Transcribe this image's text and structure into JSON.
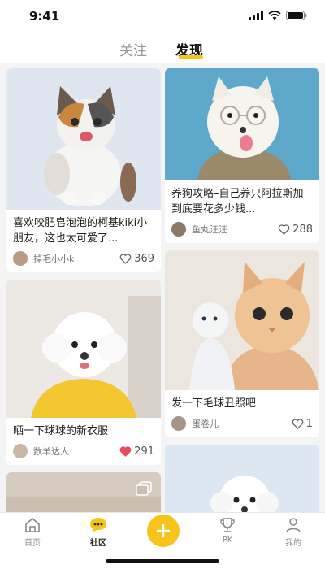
{
  "status_bar": {
    "time": "9:41"
  },
  "top_tabs": {
    "follow": "关注",
    "discover": "发现",
    "active": "discover"
  },
  "feed": {
    "left": [
      {
        "title": "喜欢咬肥皂泡泡的柯基kiki小朋友，这也太可爱了...",
        "author": "掉毛小小k",
        "likes": "369",
        "liked": false,
        "image": "calico-kitten-photo"
      },
      {
        "title": "晒一下球球的新衣服",
        "author": "数羊达人",
        "likes": "291",
        "liked": true,
        "image": "white-poodle-yellow-shirt-photo"
      },
      {
        "image": "partial-photo-with-multi-image-icon"
      }
    ],
    "right": [
      {
        "title": "养狗攻略–自己养只阿拉斯加到底要花多少钱...",
        "author": "鱼丸汪汪",
        "likes": "288",
        "liked": false,
        "image": "samoyed-with-glasses-photo"
      },
      {
        "title": "发一下毛球丑照吧",
        "author": "蛋卷儿",
        "likes": "1",
        "liked": false,
        "image": "orange-cat-with-toy-photo"
      },
      {
        "image": "white-puppy-photo"
      }
    ]
  },
  "tabbar": {
    "home": "首页",
    "community": "社区",
    "pk": "PK",
    "mine": "我的",
    "active": "community"
  },
  "colors": {
    "accent": "#f5c518",
    "like_active": "#e84a5f"
  }
}
